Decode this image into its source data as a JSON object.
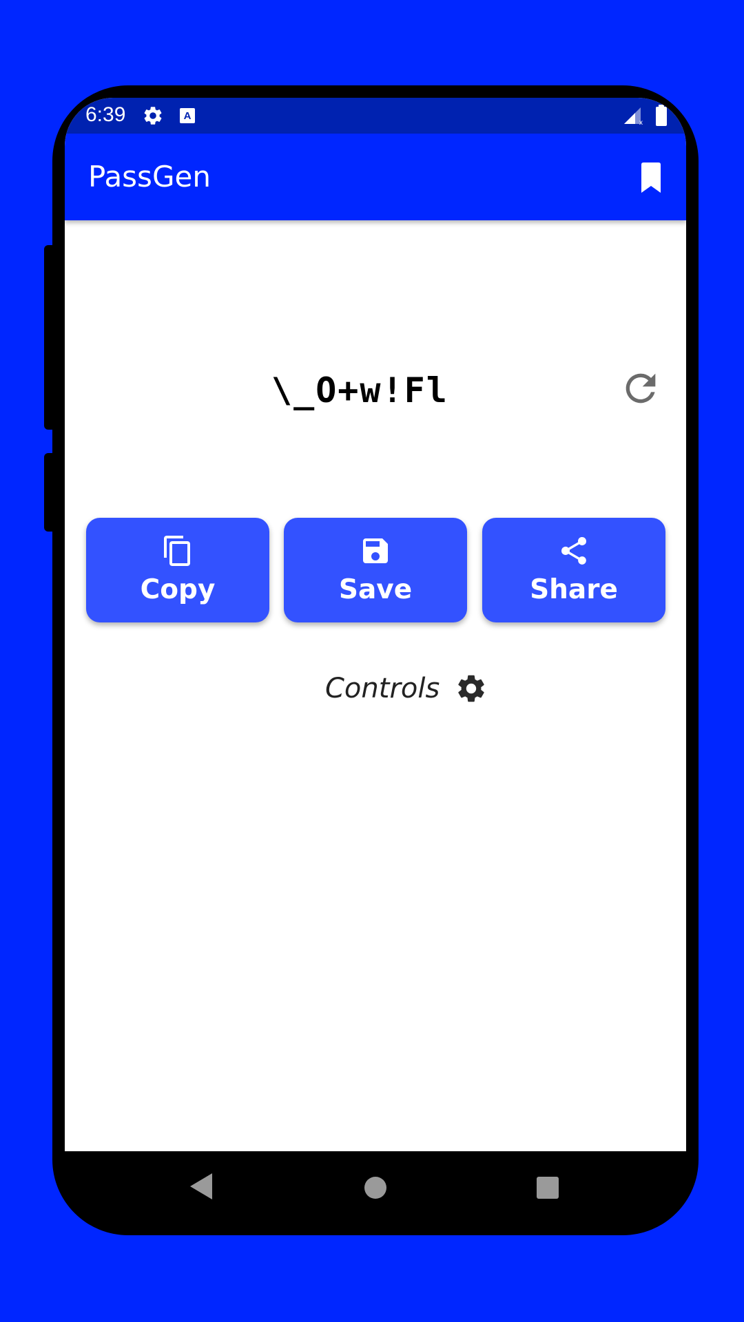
{
  "statusbar": {
    "time": "6:39",
    "icons": [
      "settings-icon",
      "keyboard-a-icon",
      "signal-icon",
      "battery-icon"
    ]
  },
  "appbar": {
    "title": "PassGen",
    "action_icon": "bookmark-icon"
  },
  "generator": {
    "password": "\\_O+w!Fl",
    "refresh_icon": "refresh-icon"
  },
  "actions": {
    "copy_label": "Copy",
    "save_label": "Save",
    "share_label": "Share"
  },
  "controls": {
    "label": "Controls",
    "icon": "gear-icon"
  },
  "navigation": {
    "icons": [
      "back-icon",
      "home-icon",
      "recents-icon"
    ]
  },
  "colors": {
    "background": "#0026FF",
    "appbar": "#0026FF",
    "statusbar": "#0022B0",
    "button": "#3352FF",
    "text_dark": "#222222"
  }
}
